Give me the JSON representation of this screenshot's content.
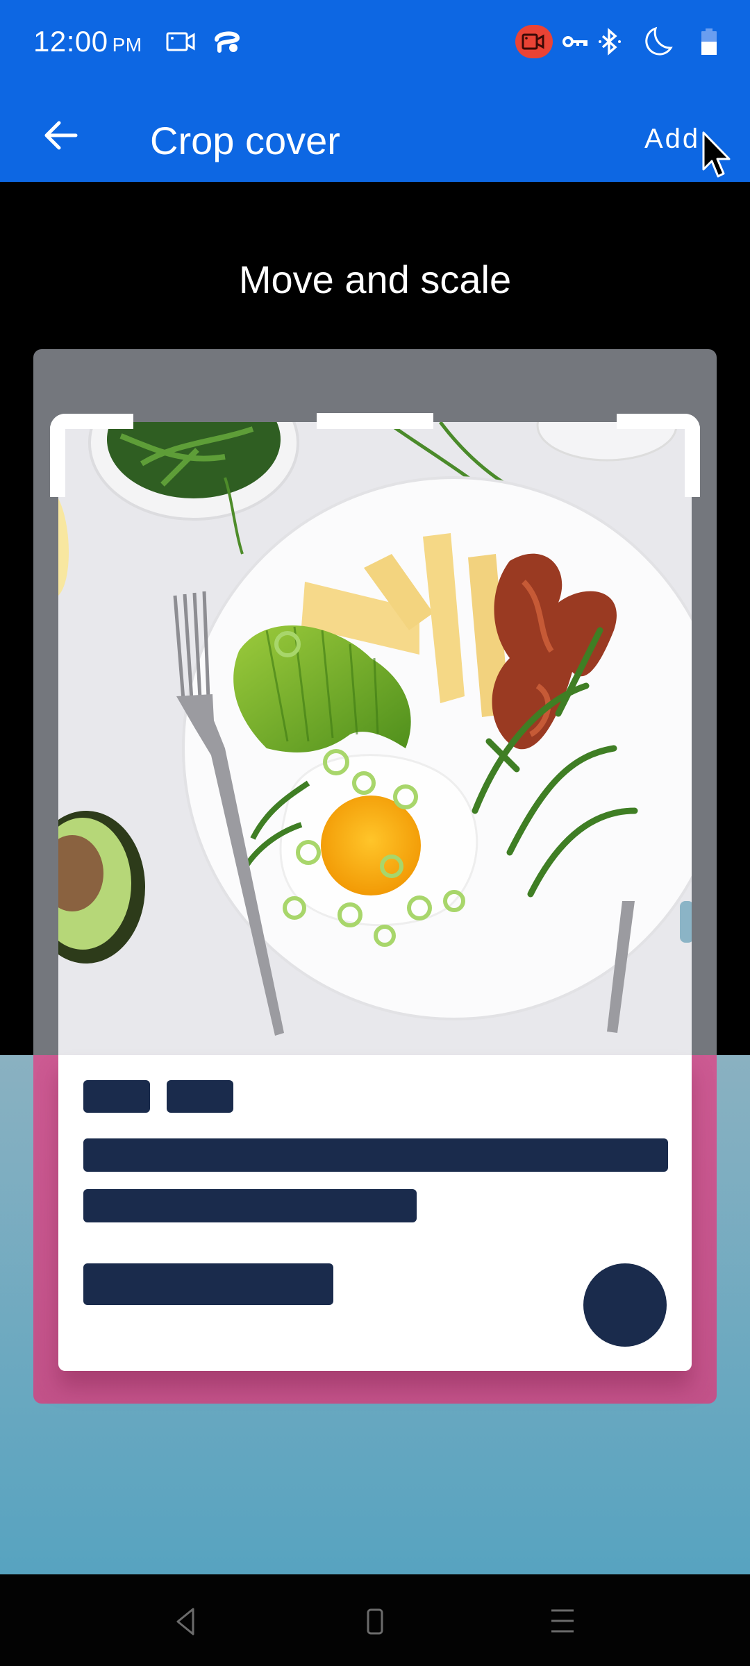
{
  "status_bar": {
    "time": "12:00",
    "ampm": "PM",
    "left_icons": [
      "screen-record-icon",
      "car-mode-icon"
    ],
    "right_icons": [
      "screen-recording-active-icon",
      "vpn-key-icon",
      "bluetooth-icon",
      "do-not-disturb-moon-icon",
      "battery-icon"
    ],
    "battery_level": 0.55,
    "recording_color": "#ea4335"
  },
  "app_bar": {
    "back_icon": "arrow-left-icon",
    "title": "Crop cover",
    "action_label": "Add",
    "color": "#0d67e3"
  },
  "editor": {
    "instruction": "Move and scale",
    "image_description": "Keto breakfast plate: fried egg, avocado slices, cheese sticks, bacon, arugula, fork and knife",
    "preview_card": {
      "accent_color": "#c8578e",
      "skeleton_color": "#1a2b4c"
    }
  },
  "nav_bar": {
    "buttons": [
      "back",
      "home",
      "recents"
    ]
  }
}
